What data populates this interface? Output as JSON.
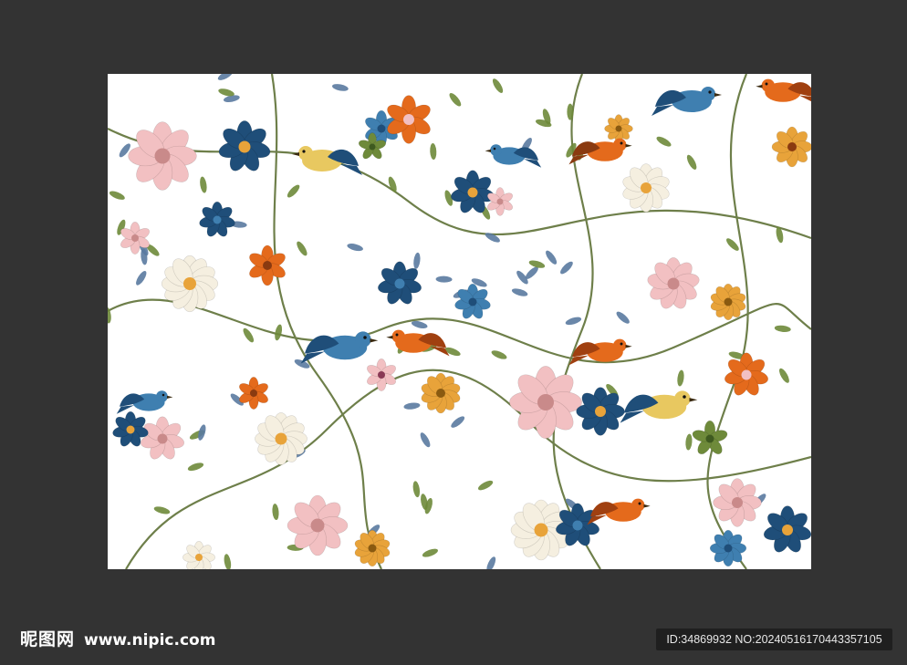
{
  "colors": {
    "page_background": "#333333",
    "image_background": "#ffffff",
    "badge_background": "#1f1f1f",
    "palette": [
      "#1f4e79",
      "#3f7fb0",
      "#e46a1c",
      "#f2c0c2",
      "#e8a33a",
      "#6e8a3a",
      "#8a3a55",
      "#f5efe0"
    ]
  },
  "image": {
    "subject": "floral-pattern-with-birds"
  },
  "watermark": {
    "brand": "昵图网",
    "url": "www.nipic.com"
  },
  "badge": {
    "text": "ID:34869932 NO:20240516170443357105"
  }
}
